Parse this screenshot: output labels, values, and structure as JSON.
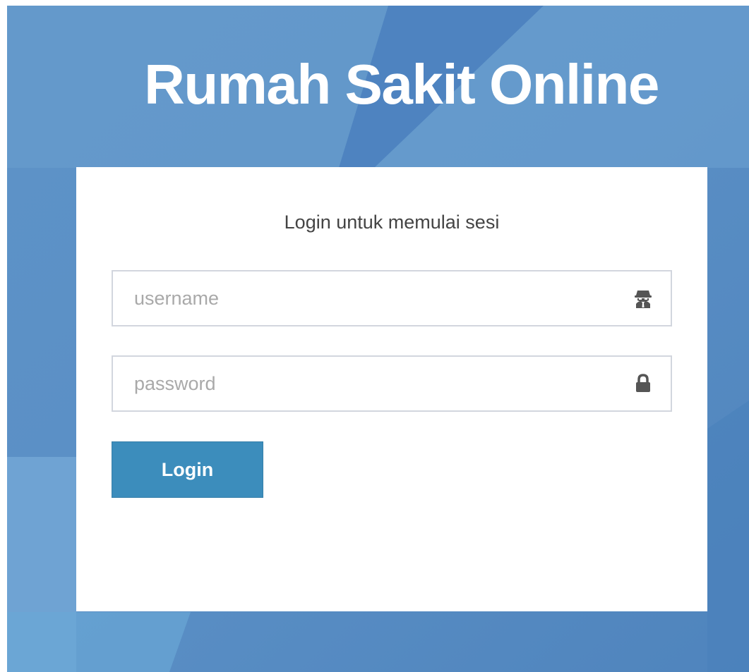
{
  "app": {
    "title": "Rumah Sakit Online"
  },
  "login": {
    "message": "Login untuk memulai sesi",
    "username": {
      "value": "",
      "placeholder": "username",
      "icon": "user-secret-icon"
    },
    "password": {
      "value": "",
      "placeholder": "password",
      "icon": "lock-icon"
    },
    "submit_label": "Login"
  },
  "colors": {
    "background": "#5b8fc4",
    "primary_button": "#3c8dbc",
    "input_border": "#d2d6de",
    "icon": "#555555"
  }
}
